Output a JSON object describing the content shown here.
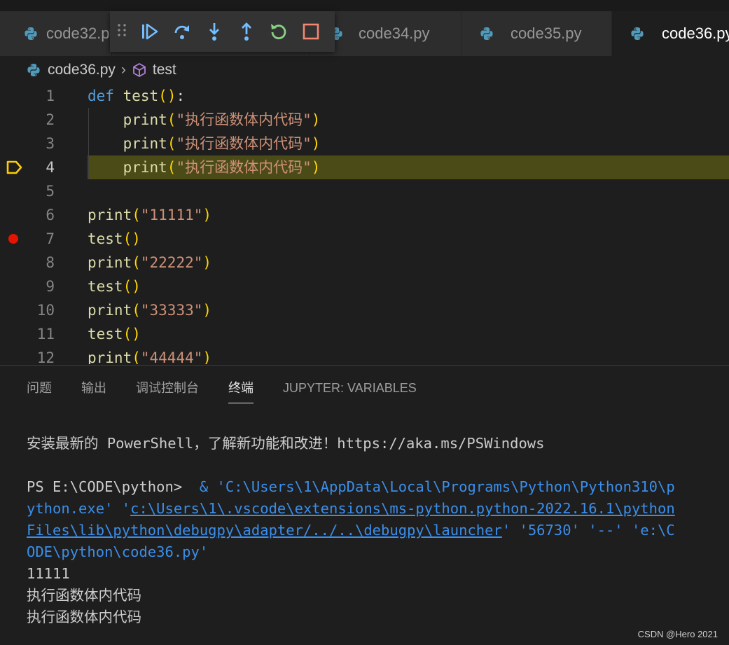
{
  "tabs": [
    {
      "label": "code32.py",
      "active": false
    },
    {
      "label": "code34.py",
      "active": false
    },
    {
      "label": "code35.py",
      "active": false
    },
    {
      "label": "code36.py",
      "active": true
    }
  ],
  "debug_toolbar": {
    "buttons": [
      "drag-handle",
      "continue",
      "step-over",
      "step-into",
      "step-out",
      "restart",
      "stop"
    ],
    "colors": {
      "blue": "#75beff",
      "green": "#89d185",
      "red": "#f48771"
    }
  },
  "breadcrumb": {
    "file": "code36.py",
    "symbol": "test"
  },
  "editor": {
    "current_line": 4,
    "breakpoint_line": 7,
    "lines": [
      {
        "n": "1",
        "text": "def test():"
      },
      {
        "n": "2",
        "text": "    print(\"执行函数体内代码\")"
      },
      {
        "n": "3",
        "text": "    print(\"执行函数体内代码\")"
      },
      {
        "n": "4",
        "text": "    print(\"执行函数体内代码\")"
      },
      {
        "n": "5",
        "text": ""
      },
      {
        "n": "6",
        "text": "print(\"11111\")"
      },
      {
        "n": "7",
        "text": "test()"
      },
      {
        "n": "8",
        "text": "print(\"22222\")"
      },
      {
        "n": "9",
        "text": "test()"
      },
      {
        "n": "10",
        "text": "print(\"33333\")"
      },
      {
        "n": "11",
        "text": "test()"
      },
      {
        "n": "12",
        "text": "print(\"44444\")"
      }
    ]
  },
  "panel": {
    "tabs": [
      "问题",
      "输出",
      "调试控制台",
      "终端",
      "JUPYTER: VARIABLES"
    ],
    "active_tab": "终端"
  },
  "terminal": {
    "banner": "安装最新的 PowerShell，了解新功能和改进！https://aka.ms/PSWindows",
    "prompt": "PS E:\\CODE\\python> ",
    "cmd_line1_rest": "& 'C:\\Users\\1\\AppData\\Local\\Programs\\Python\\Python310\\p",
    "cmd_line2_a": "ython.exe' '",
    "cmd_line2_link": "c:\\Users\\1\\.vscode\\extensions\\ms-python.python-2022.16.1\\python",
    "cmd_line3_link": "Files\\lib\\python\\debugpy\\adapter/../..\\debugpy\\launcher",
    "cmd_line3_rest": "' '56730' '--' 'e:\\C",
    "cmd_line4": "ODE\\python\\code36.py'",
    "output": [
      "11111",
      "执行函数体内代码",
      "执行函数体内代码"
    ]
  },
  "watermark": "CSDN @Hero 2021"
}
